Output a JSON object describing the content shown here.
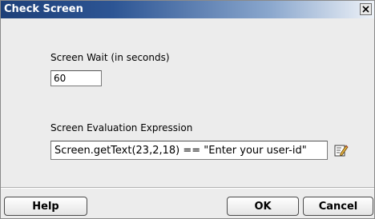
{
  "window": {
    "title": "Check Screen",
    "close_icon": "close-icon"
  },
  "form": {
    "wait_label": "Screen Wait (in seconds)",
    "wait_value": "60",
    "expression_label": "Screen Evaluation Expression",
    "expression_value": "Screen.getText(23,2,18) == \"Enter your user-id\"",
    "edit_icon": "edit-expression-icon"
  },
  "buttons": {
    "help": "Help",
    "ok": "OK",
    "cancel": "Cancel"
  }
}
